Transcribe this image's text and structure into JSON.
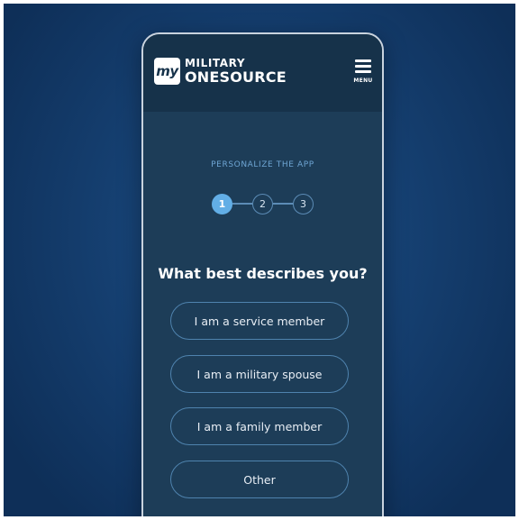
{
  "header": {
    "logo_badge": "my",
    "logo_line1": "MILITARY",
    "logo_line2": "ONESOURCE",
    "menu_label": "MENU"
  },
  "personalize": {
    "kicker": "PERSONALIZE THE APP",
    "steps": [
      "1",
      "2",
      "3"
    ],
    "active_step": 1
  },
  "question": "What best describes you?",
  "options": [
    "I am a service member",
    "I am a military spouse",
    "I am a family member",
    "Other"
  ],
  "colors": {
    "background": "#164173",
    "phone_body": "#1d3d58",
    "header": "#16324a",
    "accent": "#62aee6",
    "outline": "#4f83ae"
  },
  "icons": {
    "menu": "hamburger-menu-icon"
  }
}
